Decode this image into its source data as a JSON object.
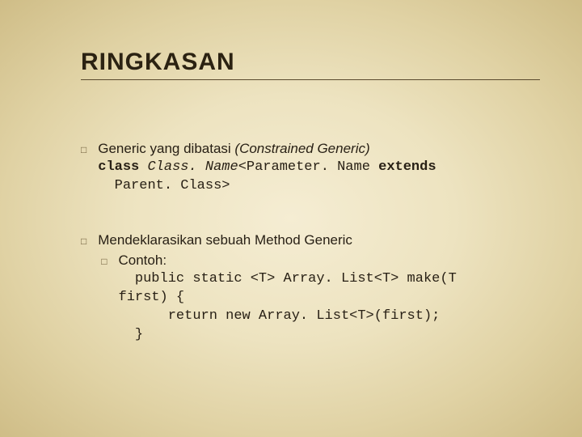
{
  "title": "RINGKASAN",
  "items": [
    {
      "text_plain": "Generic yang dibatasi ",
      "text_italic": "(Constrained Generic)",
      "code_kw1": "class ",
      "code_mid": "Class. Name",
      "code_mid2": "<Parameter. Name ",
      "code_kw2": "extends",
      "code_line2": "  Parent. Class>"
    },
    {
      "text_plain": "Mendeklarasikan sebuah Method Generic",
      "sub_label": "Contoh:",
      "code_line1": "  public static <T> Array. List<T> make(T",
      "code_line2": "first) {",
      "code_line3": "      return new Array. List<T>(first);",
      "code_line4": "  }"
    }
  ]
}
